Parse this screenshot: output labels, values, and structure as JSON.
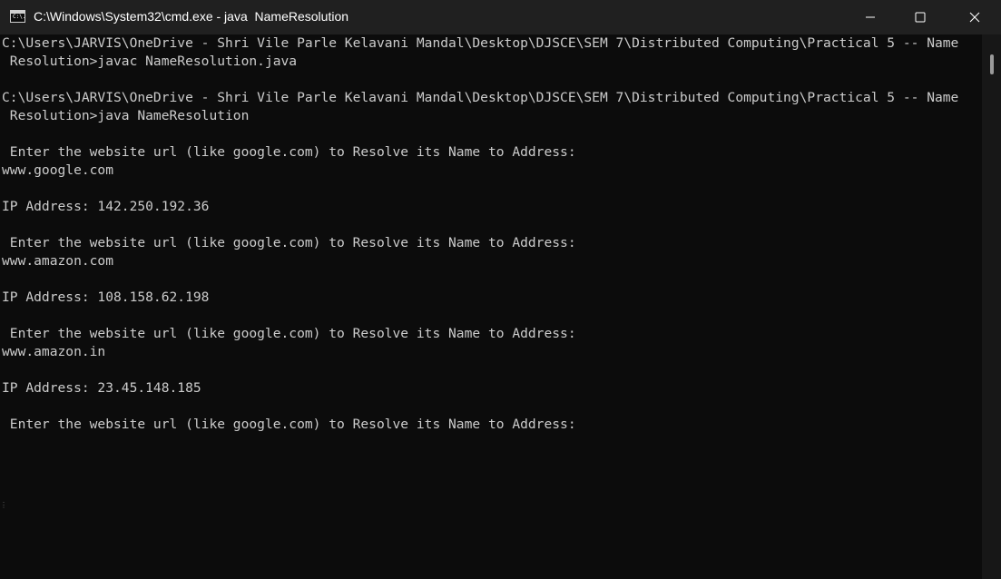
{
  "window": {
    "title": "C:\\Windows\\System32\\cmd.exe - java  NameResolution",
    "icon": "cmd-icon",
    "icon_glyph": "C:\\."
  },
  "title_controls": {
    "minimize": "minimize-icon",
    "maximize": "maximize-icon",
    "close": "close-icon"
  },
  "console": {
    "lines": [
      "C:\\Users\\JARVIS\\OneDrive - Shri Vile Parle Kelavani Mandal\\Desktop\\DJSCE\\SEM 7\\Distributed Computing\\Practical 5 -- Name",
      " Resolution>javac NameResolution.java",
      "",
      "C:\\Users\\JARVIS\\OneDrive - Shri Vile Parle Kelavani Mandal\\Desktop\\DJSCE\\SEM 7\\Distributed Computing\\Practical 5 -- Name",
      " Resolution>java NameResolution",
      "",
      " Enter the website url (like google.com) to Resolve its Name to Address:",
      "www.google.com",
      "",
      "IP Address: 142.250.192.36",
      "",
      " Enter the website url (like google.com) to Resolve its Name to Address:",
      "www.amazon.com",
      "",
      "IP Address: 108.158.62.198",
      "",
      " Enter the website url (like google.com) to Resolve its Name to Address:",
      "www.amazon.in",
      "",
      "IP Address: 23.45.148.185",
      "",
      " Enter the website url (like google.com) to Resolve its Name to Address:"
    ]
  },
  "colors": {
    "console_bg": "#0c0c0c",
    "console_fg": "#cccccc",
    "titlebar_bg": "#202020"
  }
}
